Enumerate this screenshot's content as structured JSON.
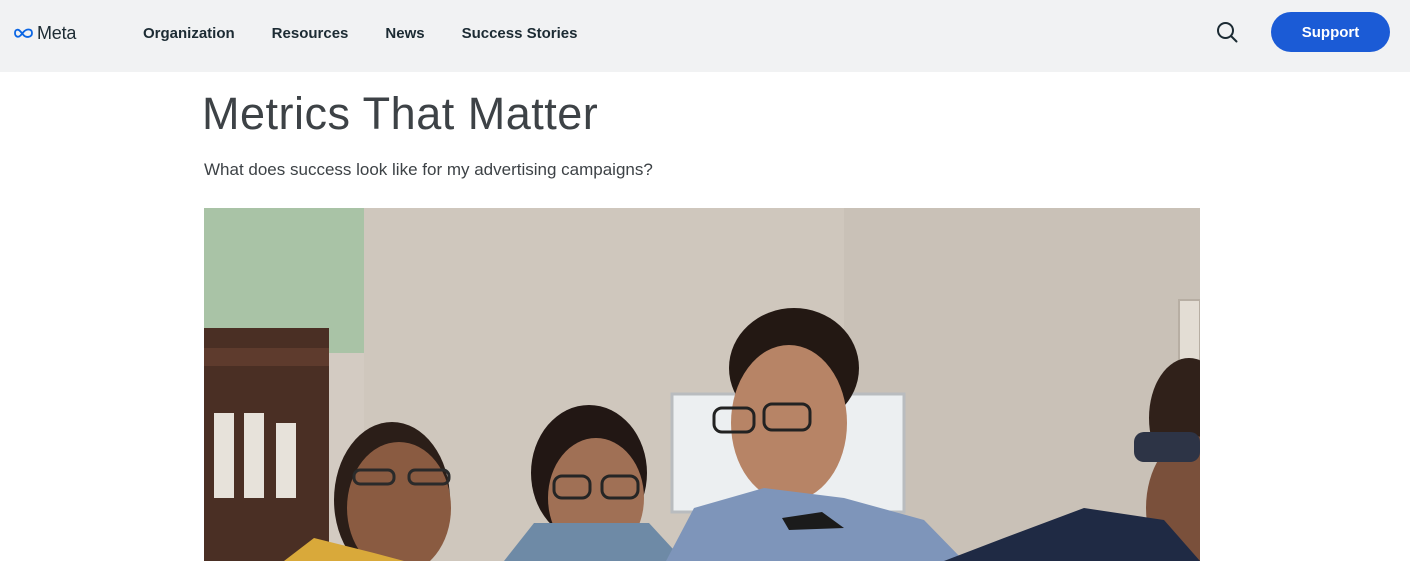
{
  "header": {
    "logo_text": "Meta",
    "nav": [
      {
        "label": "Organization"
      },
      {
        "label": "Resources"
      },
      {
        "label": "News"
      },
      {
        "label": "Success Stories"
      }
    ],
    "search_icon": "search-icon",
    "support_label": "Support",
    "accent_color": "#1b5bd6"
  },
  "main": {
    "title": "Metrics That Matter",
    "subtitle": "What does success look like for my advertising campaigns?"
  }
}
